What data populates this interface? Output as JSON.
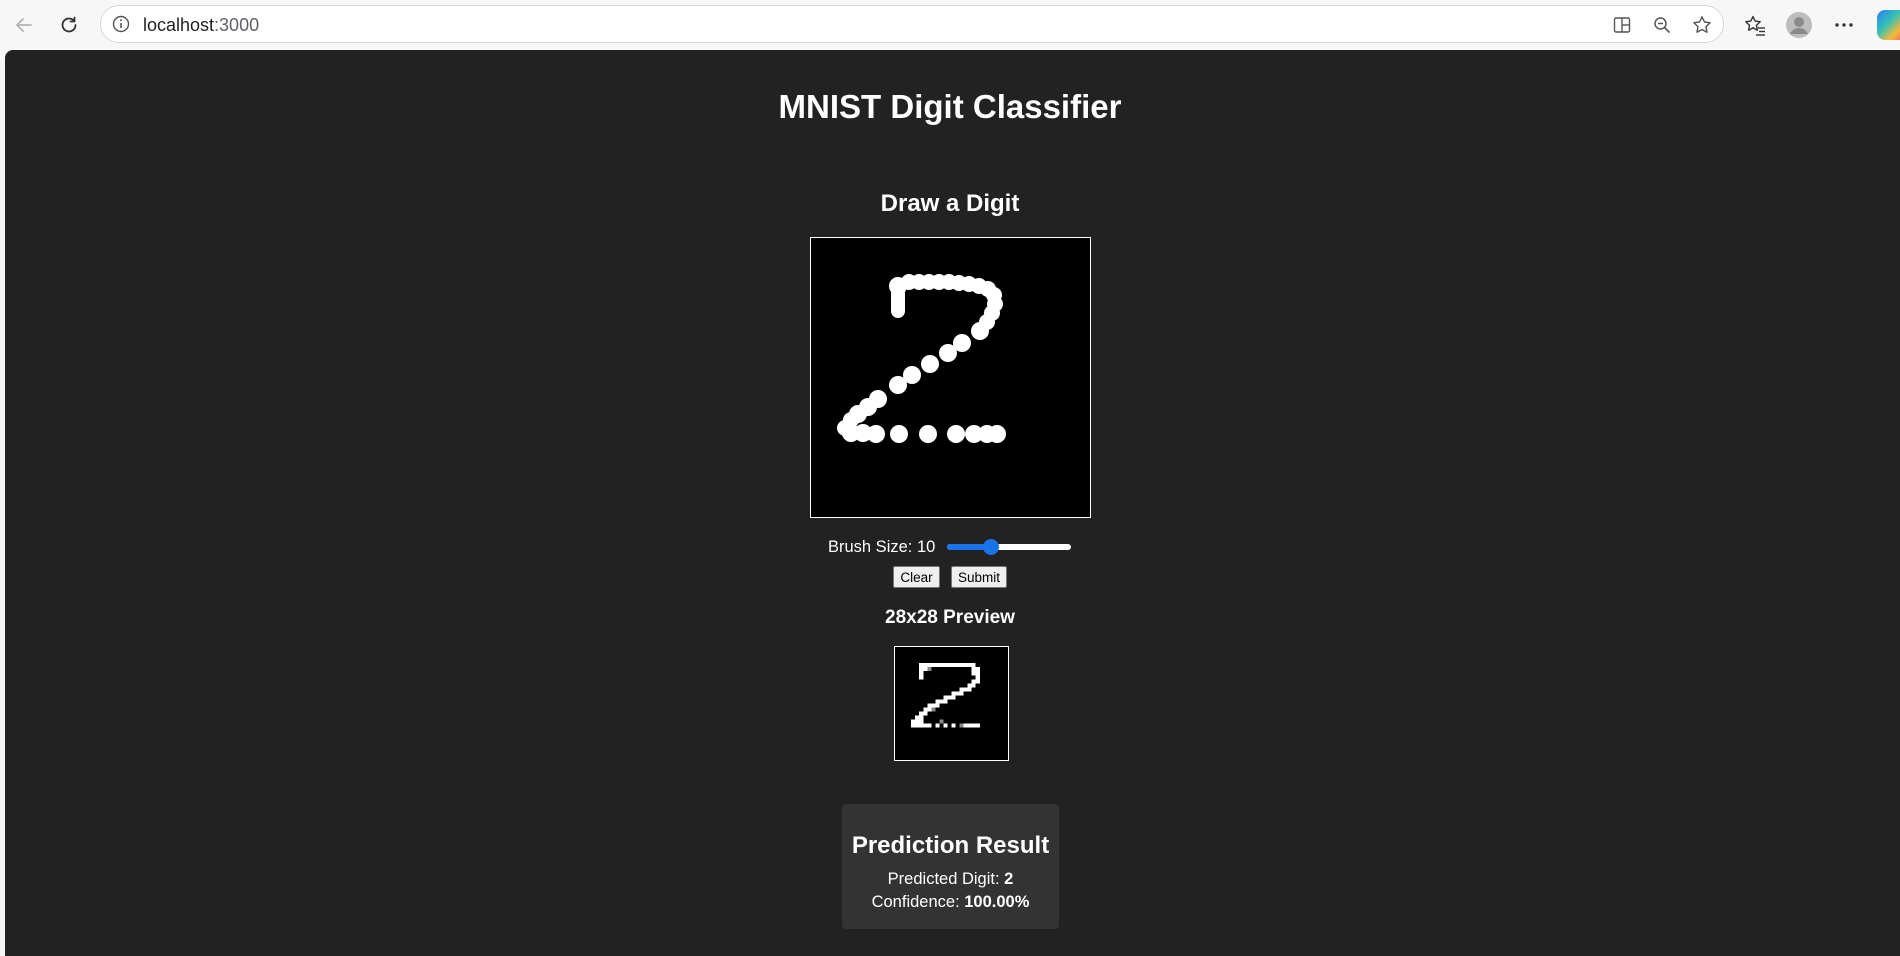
{
  "browser": {
    "url_host": "localhost",
    "url_port": ":3000",
    "icons": {
      "back": "arrow-left-icon",
      "reload": "reload-icon",
      "site_info": "info-icon",
      "split_screen": "split-screen-icon",
      "zoom": "zoom-out-icon",
      "favorite": "star-icon",
      "favorites_bar": "favorites-icon",
      "profile": "profile-icon",
      "more": "more-icon",
      "copilot": "copilot-icon"
    }
  },
  "page": {
    "title": "MNIST Digit Classifier",
    "draw_heading": "Draw a Digit",
    "brush_label": "Brush Size: 10",
    "brush_value": 10,
    "brush_fraction": 0.34,
    "clear_label": "Clear",
    "submit_label": "Submit",
    "preview_heading": "28x28 Preview"
  },
  "result": {
    "title": "Prediction Result",
    "digit_label": "Predicted Digit: ",
    "digit_value": "2",
    "confidence_label": "Confidence: ",
    "confidence_value": "100.00%"
  },
  "colors": {
    "page_bg": "#222222",
    "card_bg": "#333333",
    "accent": "#1a73e8"
  }
}
